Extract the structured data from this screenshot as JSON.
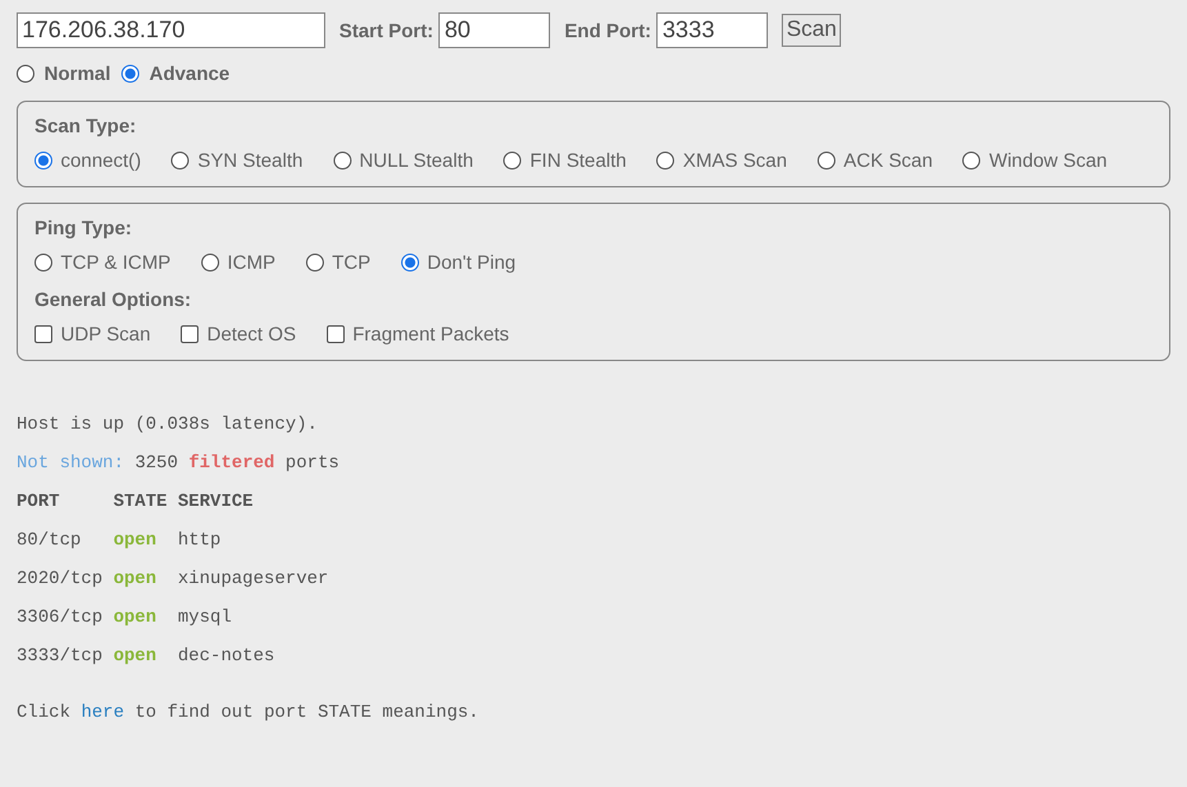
{
  "target": {
    "host": "176.206.38.170",
    "start_port_label": "Start Port:",
    "start_port": "80",
    "end_port_label": "End Port:",
    "end_port": "3333",
    "scan_button": "Scan"
  },
  "modes": [
    {
      "label": "Normal",
      "selected": false
    },
    {
      "label": "Advance",
      "selected": true
    }
  ],
  "scan_type": {
    "title": "Scan Type:",
    "options": [
      {
        "label": "connect()",
        "selected": true
      },
      {
        "label": "SYN Stealth",
        "selected": false
      },
      {
        "label": "NULL Stealth",
        "selected": false
      },
      {
        "label": "FIN Stealth",
        "selected": false
      },
      {
        "label": "XMAS Scan",
        "selected": false
      },
      {
        "label": "ACK Scan",
        "selected": false
      },
      {
        "label": "Window Scan",
        "selected": false
      }
    ]
  },
  "ping_type": {
    "title": "Ping Type:",
    "options": [
      {
        "label": "TCP & ICMP",
        "selected": false
      },
      {
        "label": "ICMP",
        "selected": false
      },
      {
        "label": "TCP",
        "selected": false
      },
      {
        "label": "Don't Ping",
        "selected": true
      }
    ]
  },
  "general_options": {
    "title": "General Options:",
    "options": [
      {
        "label": "UDP Scan",
        "checked": false
      },
      {
        "label": "Detect OS",
        "checked": false
      },
      {
        "label": "Fragment Packets",
        "checked": false
      }
    ]
  },
  "output": {
    "host_line": "Host is up (0.038s latency).",
    "not_shown": [
      {
        "kind": "label",
        "text": "Not shown:"
      },
      {
        "kind": "plain",
        "text": "3250"
      },
      {
        "kind": "filtered",
        "text": "filtered"
      },
      {
        "kind": "plain",
        "text": "ports"
      }
    ],
    "columns": [
      "PORT",
      "STATE",
      "SERVICE"
    ],
    "rows": [
      {
        "port": "80/tcp",
        "state": "open",
        "service": "http"
      },
      {
        "port": "2020/tcp",
        "state": "open",
        "service": "xinupageserver"
      },
      {
        "port": "3306/tcp",
        "state": "open",
        "service": "mysql"
      },
      {
        "port": "3333/tcp",
        "state": "open",
        "service": "dec-notes"
      }
    ],
    "footer": {
      "before": "Click",
      "link": "here",
      "after": "to find out port STATE meanings."
    }
  }
}
